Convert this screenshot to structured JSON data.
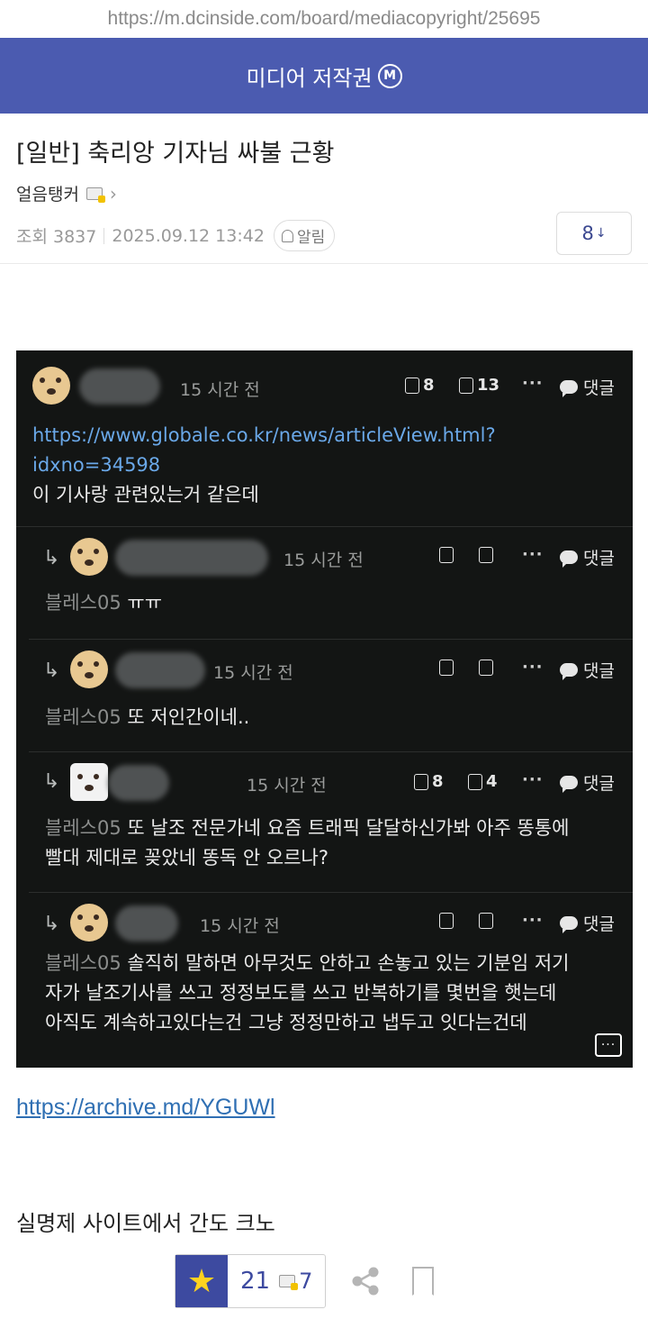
{
  "url": "https://m.dcinside.com/board/mediacopyright/25695",
  "board": {
    "title": "미디어 저작권",
    "badge": "M"
  },
  "post": {
    "title": "[일반] 축리앙 기자님 싸불 근황",
    "author": "얼음탱커",
    "views": "조회 3837",
    "date": "2025.09.12 13:42",
    "alarm_label": "알림",
    "comment_count": "8",
    "comment_arrow": "↓",
    "archive_link": "https://archive.md/YGUWl",
    "text": "실명제 사이트에서 간도 크노"
  },
  "screenshot": {
    "reply_label": "댓글",
    "comments": [
      {
        "time": "15 시간 전",
        "likes": "8",
        "dislikes": "13",
        "link_line1": "https://www.globale.co.kr/news/articleView.html?",
        "link_line2": "idxno=34598",
        "text": "이 기사랑 관련있는거 같은데"
      },
      {
        "time": "15 시간 전",
        "mention": "블레스05",
        "text": "ㅠㅠ"
      },
      {
        "time": "15 시간 전",
        "mention": "블레스05",
        "text": "또 저인간이네.."
      },
      {
        "time": "15 시간 전",
        "likes": "8",
        "dislikes": "4",
        "mention": "블레스05",
        "line1": "또 날조 전문가네 요즘 트래픽 달달하신가봐 아주 똥통에",
        "line2": "빨대 제대로 꽂았네 똥독 안 오르나?"
      },
      {
        "time": "15 시간 전",
        "mention": "블레스05",
        "line1": "솔직히 말하면 아무것도 안하고 손놓고 있는 기분임 저기",
        "line2": "자가 날조기사를 쓰고 정정보도를 쓰고 반복하기를 몇번을 햇는데",
        "line3": "아직도 계속하고있다는건 그냥 정정만하고 냅두고 잇다는건데"
      }
    ]
  },
  "actions": {
    "recommend_count": "21",
    "fixed_count": "7"
  },
  "colors": {
    "header": "#4b5bb0",
    "accent": "#3d4aa0",
    "star": "#ffd21f",
    "link": "#2f6fb3"
  }
}
